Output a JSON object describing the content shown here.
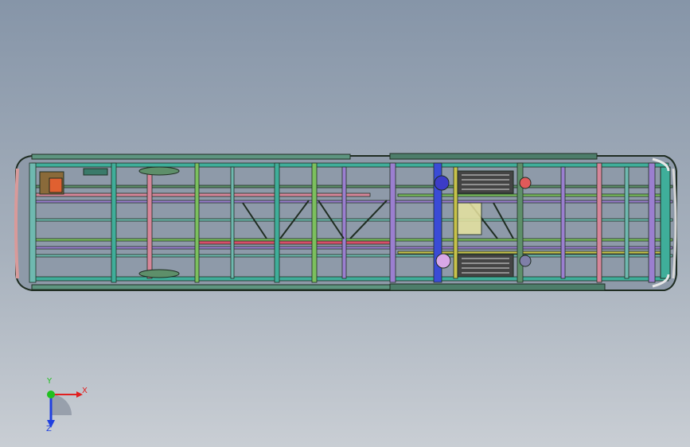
{
  "viewport": {
    "background_top": "#8695a8",
    "background_bottom": "#c9ced4"
  },
  "model": {
    "description_icon": "bus-chassis-frame-bottom-view",
    "outline_color": "#2c3e32",
    "member_colors": [
      "#3fae9a",
      "#6fb9b0",
      "#d6869a",
      "#9b7fd0",
      "#7cc05e",
      "#3a4bd6",
      "#c8c24a",
      "#e0e0e0",
      "#5e8f6a"
    ],
    "fuel_tank_color": "#3c3cc8",
    "highlight_color": "#e05a5a"
  },
  "triad": {
    "x_label": "X",
    "y_label": "Y",
    "z_label": "Z",
    "x_color": "#e02020",
    "y_color": "#20c020",
    "z_color": "#2040e0"
  }
}
